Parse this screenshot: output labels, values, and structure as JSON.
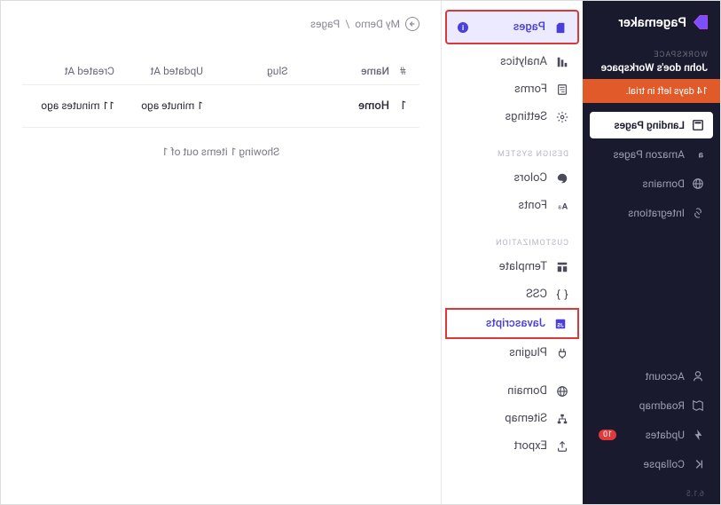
{
  "brand": {
    "name": "Pagemaker"
  },
  "workspace": {
    "label": "WORKSPACE",
    "name": "John doe's Workspace"
  },
  "trial": {
    "text": "14 days left in trial."
  },
  "left_nav": {
    "items": [
      {
        "label": "Landing Pages",
        "icon": "page"
      },
      {
        "label": "Amazon Pages",
        "icon": "amazon"
      },
      {
        "label": "Domains",
        "icon": "globe"
      },
      {
        "label": "Integrations",
        "icon": "link"
      }
    ],
    "bottom": [
      {
        "label": "Account",
        "icon": "user"
      },
      {
        "label": "Roadmap",
        "icon": "map"
      },
      {
        "label": "Updates",
        "icon": "bolt",
        "badge": "10"
      },
      {
        "label": "Collapse",
        "icon": "collapse"
      }
    ],
    "version": "6.1.5"
  },
  "mid_nav": {
    "group1": [
      {
        "label": "Pages",
        "icon": "page",
        "highlight": "pages",
        "info": true
      },
      {
        "label": "Analytics",
        "icon": "chart"
      },
      {
        "label": "Forms",
        "icon": "form"
      },
      {
        "label": "Settings",
        "icon": "gear"
      }
    ],
    "group2_label": "DESIGN SYSTEM",
    "group2": [
      {
        "label": "Colors",
        "icon": "palette"
      },
      {
        "label": "Fonts",
        "icon": "font"
      }
    ],
    "group3_label": "CUSTOMIZATION",
    "group3": [
      {
        "label": "Template",
        "icon": "template"
      },
      {
        "label": "CSS",
        "icon": "braces"
      },
      {
        "label": "Javascripts",
        "icon": "js",
        "highlight": "js"
      },
      {
        "label": "Plugins",
        "icon": "plug"
      }
    ],
    "group4": [
      {
        "label": "Domain",
        "icon": "globe"
      },
      {
        "label": "Sitemap",
        "icon": "sitemap"
      },
      {
        "label": "Export",
        "icon": "export"
      }
    ]
  },
  "breadcrumb": {
    "root": "My Demo",
    "sep": "/",
    "current": "Pages"
  },
  "table": {
    "headers": {
      "num": "#",
      "name": "Name",
      "slug": "Slug",
      "updated": "Updated At",
      "created": "Created At"
    },
    "rows": [
      {
        "num": "1",
        "name": "Home",
        "slug": "",
        "updated": "1 minute ago",
        "created": "11 minutes ago"
      }
    ],
    "footer": "Showing 1 items out of 1"
  }
}
